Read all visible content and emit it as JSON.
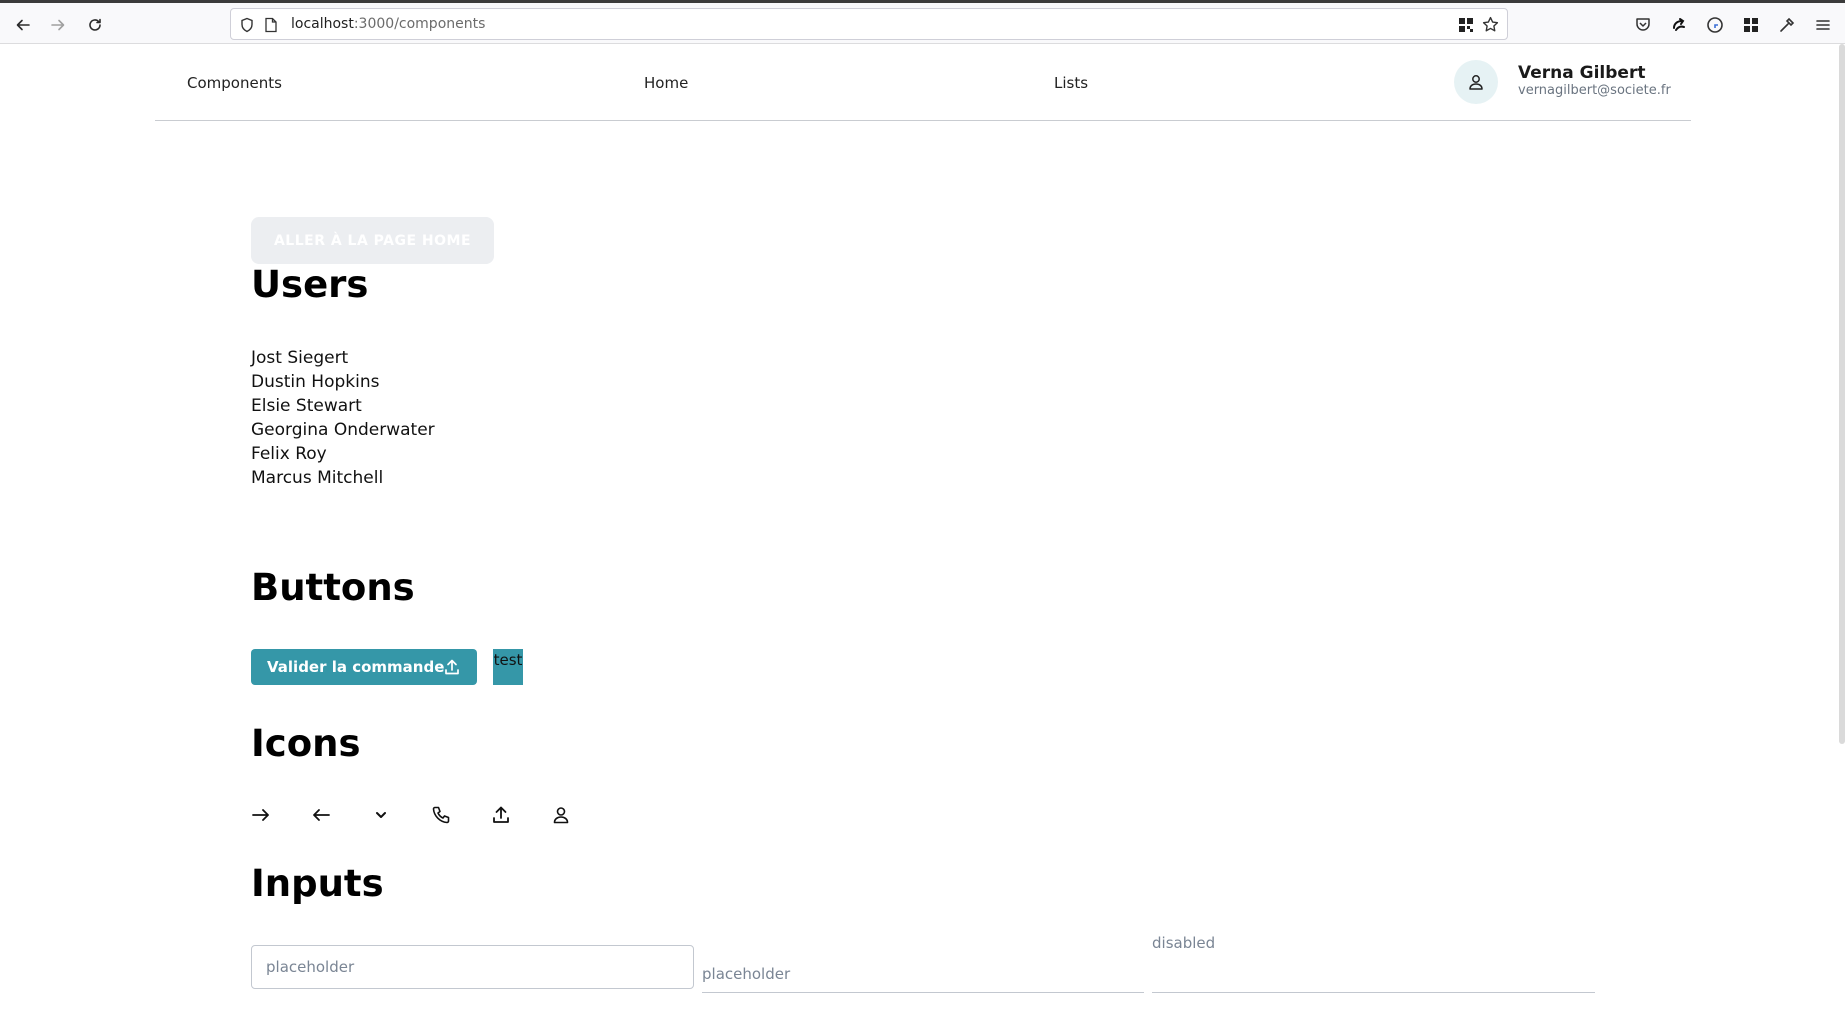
{
  "browser": {
    "url_host": "localhost",
    "url_path": ":3000/components"
  },
  "header": {
    "nav": [
      "Components",
      "Home",
      "Lists"
    ],
    "user": {
      "name": "Verna Gilbert",
      "email": "vernagilbert@societe.fr"
    }
  },
  "main": {
    "home_button_label": "ALLER À LA PAGE HOME",
    "users_title": "Users",
    "users": [
      "Jost Siegert",
      "Dustin Hopkins",
      "Elsie Stewart",
      "Georgina Onderwater",
      "Felix Roy",
      "Marcus Mitchell"
    ],
    "buttons_title": "Buttons",
    "primary_button_label": "Valider la commande",
    "test_button_label": "test",
    "icons_title": "Icons",
    "icons": [
      "arrow-right-icon",
      "arrow-left-icon",
      "chevron-down-icon",
      "phone-icon",
      "upload-icon",
      "user-icon"
    ],
    "inputs_title": "Inputs",
    "inputs": {
      "outlined_placeholder": "placeholder",
      "underlined_placeholder": "placeholder",
      "disabled_label": "disabled"
    }
  },
  "colors": {
    "primary": "#3597a8",
    "avatar_bg": "#e6f2f4",
    "ghost_button_bg": "#eceef1"
  }
}
